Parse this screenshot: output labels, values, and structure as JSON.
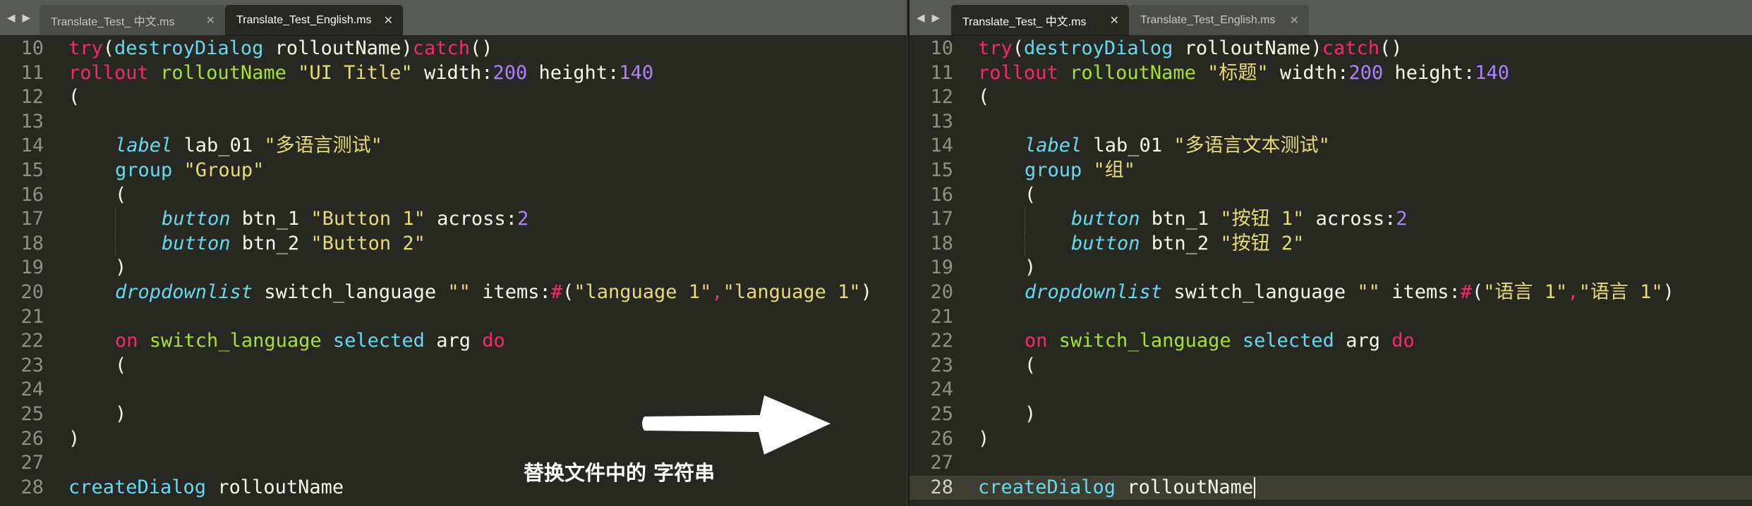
{
  "tab_nav": {
    "left": "◀",
    "right": "▶"
  },
  "close_glyph": "✕",
  "left_pane": {
    "tabs": [
      {
        "label": "Translate_Test_ 中文.ms",
        "active": false
      },
      {
        "label": "Translate_Test_English.ms",
        "active": true
      }
    ],
    "lines": [
      {
        "n": "10",
        "indent": 0,
        "t": [
          [
            "k",
            "try"
          ],
          [
            "w",
            "("
          ],
          [
            "c",
            "destroyDialog"
          ],
          [
            "w",
            " rolloutName)"
          ],
          [
            "k",
            "catch"
          ],
          [
            "w",
            "()"
          ]
        ]
      },
      {
        "n": "11",
        "indent": 0,
        "t": [
          [
            "k",
            "rollout"
          ],
          [
            "w",
            " "
          ],
          [
            "f",
            "rolloutName"
          ],
          [
            "w",
            " "
          ],
          [
            "s",
            "\"UI Title\""
          ],
          [
            "w",
            " width:"
          ],
          [
            "n",
            "200"
          ],
          [
            "w",
            " height:"
          ],
          [
            "n",
            "140"
          ]
        ]
      },
      {
        "n": "12",
        "indent": 0,
        "t": [
          [
            "w",
            "("
          ]
        ]
      },
      {
        "n": "13",
        "indent": 0,
        "t": []
      },
      {
        "n": "14",
        "indent": 1,
        "t": [
          [
            "ci",
            "label"
          ],
          [
            "w",
            " lab_01 "
          ],
          [
            "s",
            "\"多语言测试\""
          ]
        ]
      },
      {
        "n": "15",
        "indent": 1,
        "t": [
          [
            "c",
            "group"
          ],
          [
            "w",
            " "
          ],
          [
            "s",
            "\"Group\""
          ]
        ]
      },
      {
        "n": "16",
        "indent": 1,
        "t": [
          [
            "w",
            "("
          ]
        ]
      },
      {
        "n": "17",
        "indent": 2,
        "t": [
          [
            "ci",
            "button"
          ],
          [
            "w",
            " btn_1 "
          ],
          [
            "s",
            "\"Button 1\""
          ],
          [
            "w",
            " across:"
          ],
          [
            "n",
            "2"
          ]
        ]
      },
      {
        "n": "18",
        "indent": 2,
        "t": [
          [
            "ci",
            "button"
          ],
          [
            "w",
            " btn_2 "
          ],
          [
            "s",
            "\"Button 2\""
          ]
        ]
      },
      {
        "n": "19",
        "indent": 1,
        "t": [
          [
            "w",
            ")"
          ]
        ]
      },
      {
        "n": "20",
        "indent": 1,
        "t": [
          [
            "ci",
            "dropdownlist"
          ],
          [
            "w",
            " switch_language "
          ],
          [
            "s",
            "\"\""
          ],
          [
            "w",
            " items:"
          ],
          [
            "k",
            "#"
          ],
          [
            "w",
            "("
          ],
          [
            "s",
            "\"language 1\""
          ],
          [
            "k",
            ","
          ],
          [
            "s",
            "\"language 1\""
          ],
          [
            "w",
            ")"
          ]
        ]
      },
      {
        "n": "21",
        "indent": 0,
        "t": []
      },
      {
        "n": "22",
        "indent": 1,
        "t": [
          [
            "k",
            "on"
          ],
          [
            "w",
            " "
          ],
          [
            "f",
            "switch_language"
          ],
          [
            "w",
            " "
          ],
          [
            "c",
            "selected"
          ],
          [
            "w",
            " arg "
          ],
          [
            "k",
            "do"
          ]
        ]
      },
      {
        "n": "23",
        "indent": 1,
        "t": [
          [
            "w",
            "("
          ]
        ]
      },
      {
        "n": "24",
        "indent": 1,
        "t": []
      },
      {
        "n": "25",
        "indent": 1,
        "t": [
          [
            "w",
            ")"
          ]
        ]
      },
      {
        "n": "26",
        "indent": 0,
        "t": [
          [
            "w",
            ")"
          ]
        ]
      },
      {
        "n": "27",
        "indent": 0,
        "t": []
      },
      {
        "n": "28",
        "indent": 0,
        "t": [
          [
            "c",
            "createDialog"
          ],
          [
            "w",
            " rolloutName"
          ]
        ]
      }
    ]
  },
  "right_pane": {
    "tabs": [
      {
        "label": "Translate_Test_ 中文.ms",
        "active": true
      },
      {
        "label": "Translate_Test_English.ms",
        "active": false
      }
    ],
    "current_line": "28",
    "lines": [
      {
        "n": "10",
        "indent": 0,
        "t": [
          [
            "k",
            "try"
          ],
          [
            "w",
            "("
          ],
          [
            "c",
            "destroyDialog"
          ],
          [
            "w",
            " rolloutName)"
          ],
          [
            "k",
            "catch"
          ],
          [
            "w",
            "()"
          ]
        ]
      },
      {
        "n": "11",
        "indent": 0,
        "t": [
          [
            "k",
            "rollout"
          ],
          [
            "w",
            " "
          ],
          [
            "f",
            "rolloutName"
          ],
          [
            "w",
            " "
          ],
          [
            "s",
            "\"标题\""
          ],
          [
            "w",
            " width:"
          ],
          [
            "n",
            "200"
          ],
          [
            "w",
            " height:"
          ],
          [
            "n",
            "140"
          ]
        ]
      },
      {
        "n": "12",
        "indent": 0,
        "t": [
          [
            "w",
            "("
          ]
        ]
      },
      {
        "n": "13",
        "indent": 0,
        "t": []
      },
      {
        "n": "14",
        "indent": 1,
        "t": [
          [
            "ci",
            "label"
          ],
          [
            "w",
            " lab_01 "
          ],
          [
            "s",
            "\"多语言文本测试\""
          ]
        ]
      },
      {
        "n": "15",
        "indent": 1,
        "t": [
          [
            "c",
            "group"
          ],
          [
            "w",
            " "
          ],
          [
            "s",
            "\"组\""
          ]
        ]
      },
      {
        "n": "16",
        "indent": 1,
        "t": [
          [
            "w",
            "("
          ]
        ]
      },
      {
        "n": "17",
        "indent": 2,
        "t": [
          [
            "ci",
            "button"
          ],
          [
            "w",
            " btn_1 "
          ],
          [
            "s",
            "\"按钮 1\""
          ],
          [
            "w",
            " across:"
          ],
          [
            "n",
            "2"
          ]
        ]
      },
      {
        "n": "18",
        "indent": 2,
        "t": [
          [
            "ci",
            "button"
          ],
          [
            "w",
            " btn_2 "
          ],
          [
            "s",
            "\"按钮 2\""
          ]
        ]
      },
      {
        "n": "19",
        "indent": 1,
        "t": [
          [
            "w",
            ")"
          ]
        ]
      },
      {
        "n": "20",
        "indent": 1,
        "t": [
          [
            "ci",
            "dropdownlist"
          ],
          [
            "w",
            " switch_language "
          ],
          [
            "s",
            "\"\""
          ],
          [
            "w",
            " items:"
          ],
          [
            "k",
            "#"
          ],
          [
            "w",
            "("
          ],
          [
            "s",
            "\"语言 1\""
          ],
          [
            "k",
            ","
          ],
          [
            "s",
            "\"语言 1\""
          ],
          [
            "w",
            ")"
          ]
        ]
      },
      {
        "n": "21",
        "indent": 0,
        "t": []
      },
      {
        "n": "22",
        "indent": 1,
        "t": [
          [
            "k",
            "on"
          ],
          [
            "w",
            " "
          ],
          [
            "f",
            "switch_language"
          ],
          [
            "w",
            " "
          ],
          [
            "c",
            "selected"
          ],
          [
            "w",
            " arg "
          ],
          [
            "k",
            "do"
          ]
        ]
      },
      {
        "n": "23",
        "indent": 1,
        "t": [
          [
            "w",
            "("
          ]
        ]
      },
      {
        "n": "24",
        "indent": 1,
        "t": []
      },
      {
        "n": "25",
        "indent": 1,
        "t": [
          [
            "w",
            ")"
          ]
        ]
      },
      {
        "n": "26",
        "indent": 0,
        "t": [
          [
            "w",
            ")"
          ]
        ]
      },
      {
        "n": "27",
        "indent": 0,
        "t": []
      },
      {
        "n": "28",
        "indent": 0,
        "t": [
          [
            "c",
            "createDialog"
          ],
          [
            "w",
            " rolloutName"
          ]
        ]
      }
    ]
  },
  "overlay": {
    "caption": "替换文件中的 字符串",
    "arrow_color": "#ffffff"
  },
  "colors": {
    "background": "#272822",
    "keyword": "#f92672",
    "function": "#a6e22e",
    "builtin": "#66d9ef",
    "string": "#e6db74",
    "number": "#ae81ff",
    "text": "#f8f8f2"
  }
}
